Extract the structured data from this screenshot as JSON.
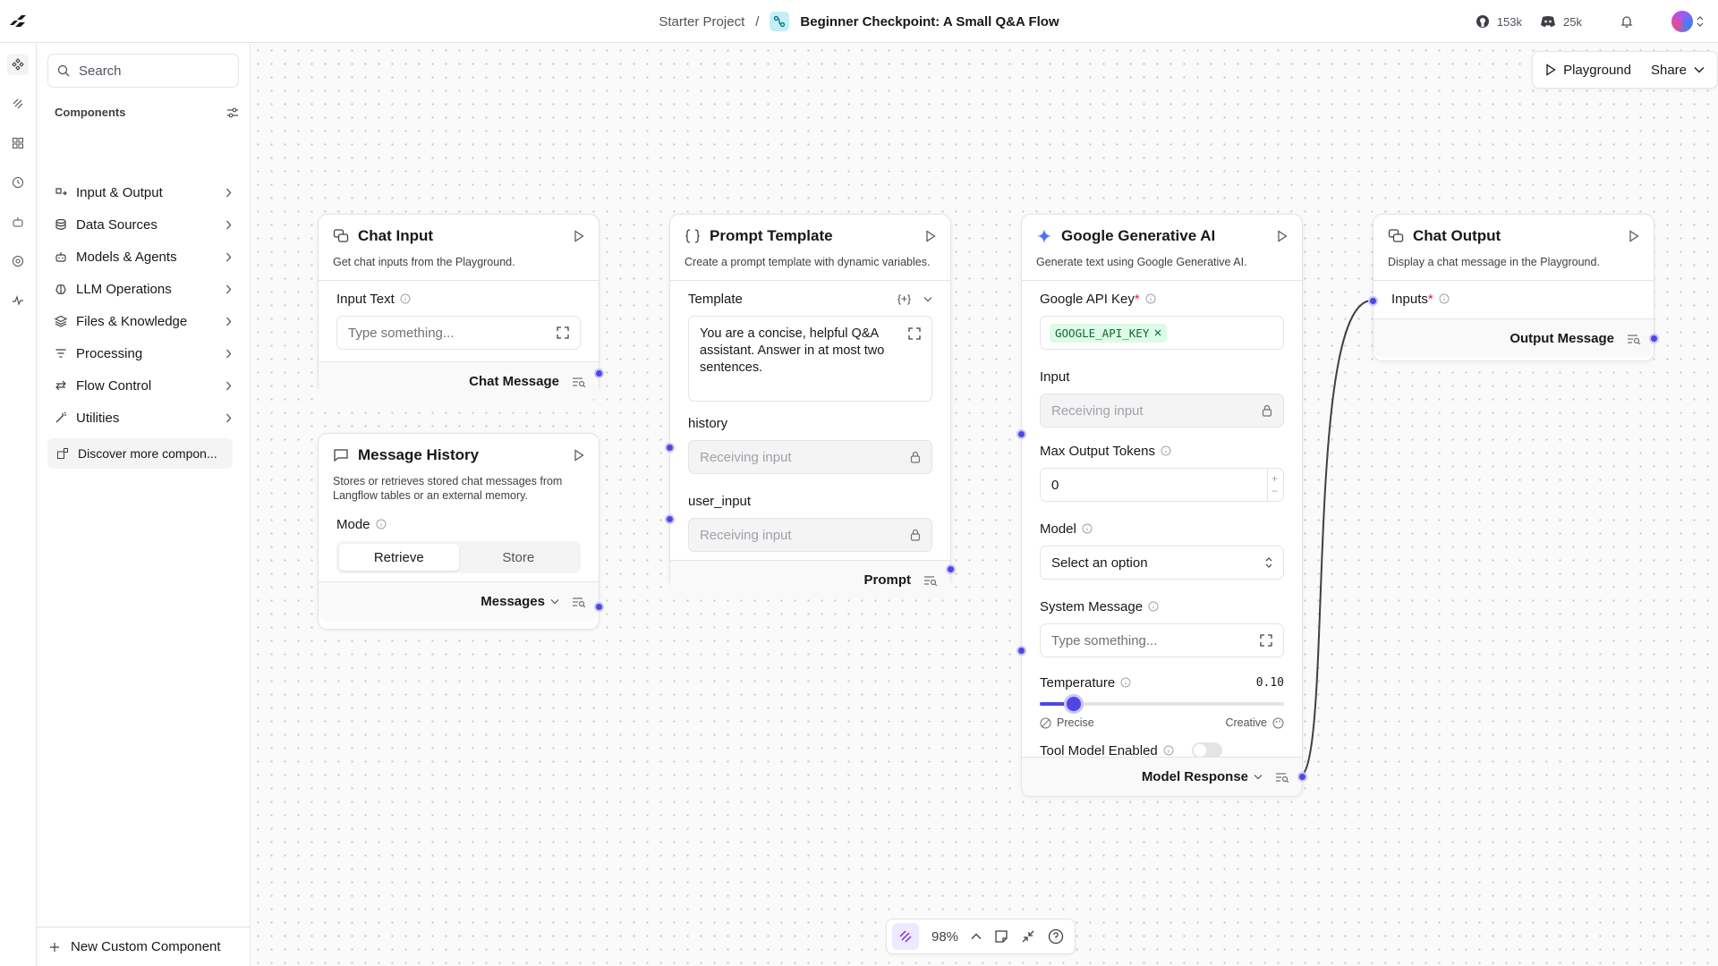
{
  "header": {
    "project": "Starter Project",
    "separator": "/",
    "flow_name": "Beginner Checkpoint: A Small Q&A Flow",
    "github_stars": "153k",
    "discord_members": "25k"
  },
  "sidebar": {
    "search_placeholder": "Search",
    "search_shortcut": "/",
    "components_heading": "Components",
    "categories": [
      {
        "label": "Input & Output",
        "icon": "io-icon"
      },
      {
        "label": "Data Sources",
        "icon": "database-icon"
      },
      {
        "label": "Models & Agents",
        "icon": "bot-icon"
      },
      {
        "label": "LLM Operations",
        "icon": "brain-icon"
      },
      {
        "label": "Files & Knowledge",
        "icon": "layers-icon"
      },
      {
        "label": "Processing",
        "icon": "filter-icon"
      },
      {
        "label": "Flow Control",
        "icon": "arrows-icon"
      },
      {
        "label": "Utilities",
        "icon": "wand-icon"
      }
    ],
    "discover_label": "Discover more compon...",
    "new_custom_label": "New Custom Component"
  },
  "toolbar": {
    "playground_label": "Playground",
    "share_label": "Share"
  },
  "nodes": {
    "chat_input": {
      "title": "Chat Input",
      "description": "Get chat inputs from the Playground.",
      "field_label": "Input Text",
      "placeholder": "Type something...",
      "output": "Chat Message"
    },
    "message_history": {
      "title": "Message History",
      "description": "Stores or retrieves stored chat messages from Langflow tables or an external memory.",
      "mode_label": "Mode",
      "mode_options": [
        "Retrieve",
        "Store"
      ],
      "output": "Messages"
    },
    "prompt_template": {
      "title": "Prompt Template",
      "description": "Create a prompt template with dynamic variables.",
      "template_label": "Template",
      "template_badge": "{+}",
      "template_text": "You are a concise, helpful Q&A assistant. Answer in at most two sentences.",
      "history_label": "history",
      "history_value": "Receiving input",
      "user_input_label": "user_input",
      "user_input_value": "Receiving input",
      "output": "Prompt"
    },
    "google_ai": {
      "title": "Google Generative AI",
      "description": "Generate text using Google Generative AI.",
      "api_key_label": "Google API Key",
      "api_key_value": "GOOGLE_API_KEY",
      "input_label": "Input",
      "input_value": "Receiving input",
      "max_tokens_label": "Max Output Tokens",
      "max_tokens_value": "0",
      "model_label": "Model",
      "model_placeholder": "Select an option",
      "system_label": "System Message",
      "system_placeholder": "Type something...",
      "temperature_label": "Temperature",
      "temperature_value": "0.10",
      "temperature_fraction": 0.1,
      "precise_label": "Precise",
      "creative_label": "Creative",
      "tool_label": "Tool Model Enabled",
      "tool_enabled": false,
      "output": "Model Response"
    },
    "chat_output": {
      "title": "Chat Output",
      "description": "Display a chat message in the Playground.",
      "inputs_label": "Inputs",
      "output": "Output Message"
    }
  },
  "controls": {
    "zoom": "98%"
  },
  "colors": {
    "accent": "#4f46e5",
    "required": "#e11d48",
    "api_chip_bg": "#dcfce7"
  }
}
